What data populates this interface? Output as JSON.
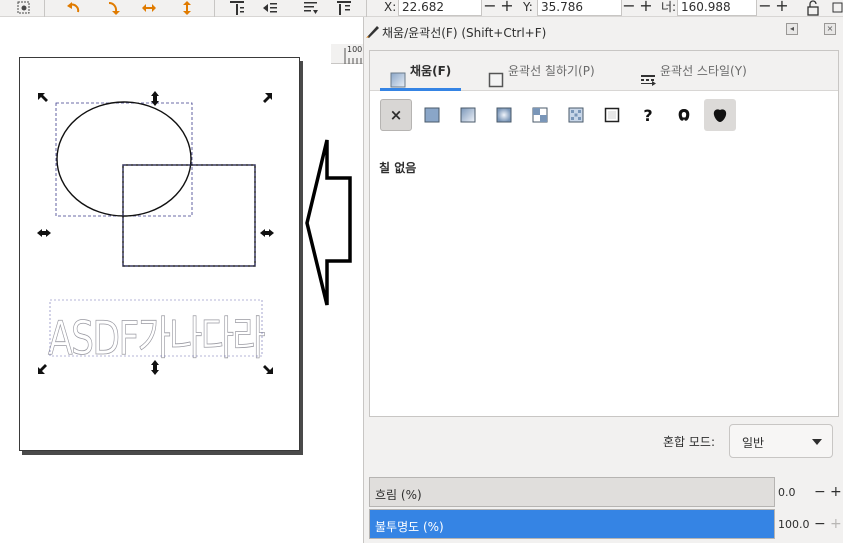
{
  "toolbar": {
    "icons": [
      "select-tool-icon",
      "rotate-ccw-icon",
      "rotate-cw-icon",
      "flip-horizontal-icon",
      "flip-vertical-icon",
      "raise-to-top-icon",
      "raise-icon",
      "lower-icon",
      "lower-to-bottom-icon"
    ],
    "x_label": "X:",
    "x_value": "22.682",
    "y_label": "Y:",
    "y_value": "35.786",
    "w_label": "너:",
    "w_value": "160.988",
    "minus": "−",
    "plus": "+"
  },
  "ruler": {
    "label": "100"
  },
  "canvas": {
    "page_color": "#ffffff",
    "text_object": "ASDF가나다라"
  },
  "dock": {
    "title": "채움/윤곽선(F) (Shift+Ctrl+F)",
    "tabs": [
      {
        "label": "채움(F)",
        "icon": "fill-tab-icon",
        "active": true
      },
      {
        "label": "윤곽선 칠하기(P)",
        "icon": "stroke-paint-tab-icon",
        "active": false
      },
      {
        "label": "윤곽선 스타일(Y)",
        "icon": "stroke-style-tab-icon",
        "active": false
      }
    ],
    "fill_buttons": [
      {
        "name": "no-paint",
        "glyph": "×"
      },
      {
        "name": "flat-color",
        "glyph": ""
      },
      {
        "name": "linear-gradient",
        "glyph": ""
      },
      {
        "name": "radial-gradient",
        "glyph": ""
      },
      {
        "name": "pattern",
        "glyph": ""
      },
      {
        "name": "swatch",
        "glyph": ""
      },
      {
        "name": "unset-paint",
        "glyph": ""
      },
      {
        "name": "unknown-paint",
        "glyph": "?"
      },
      {
        "name": "fill-rule-evenodd",
        "glyph": ""
      },
      {
        "name": "fill-rule-nonzero",
        "glyph": ""
      }
    ],
    "no_fill_text": "칠 없음",
    "blend": {
      "label": "혼합 모드:",
      "value": "일반"
    },
    "blur": {
      "label": "흐림 (%)",
      "value": "0.0",
      "fraction": 0.0
    },
    "opacity": {
      "label": "불투명도 (%)",
      "value": "100.0",
      "fraction": 1.0
    },
    "accent": "#3584e4"
  }
}
